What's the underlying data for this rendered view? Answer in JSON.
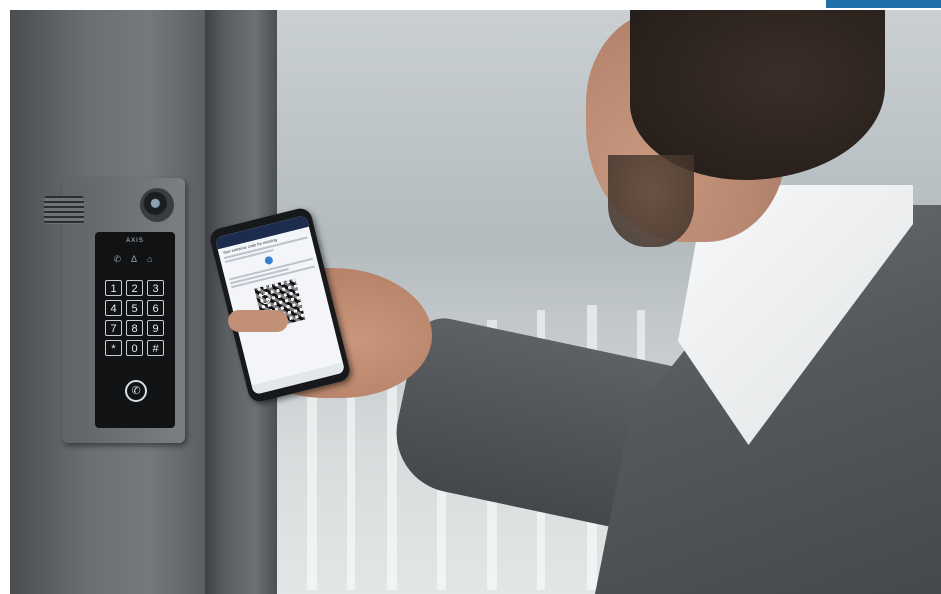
{
  "photo": {
    "description_icons": [
      "intercom-keypad",
      "smartphone-qr-code"
    ],
    "intercom": {
      "brand": "AXIS",
      "keys": [
        "1",
        "2",
        "3",
        "4",
        "5",
        "6",
        "7",
        "8",
        "9",
        "*",
        "0",
        "#"
      ],
      "call_glyph": "✆",
      "status_glyphs": "✆ Δ ⌂"
    },
    "phone": {
      "screen_title": "Your entrance code for meeting",
      "qr_visible": true
    },
    "colors": {
      "accent_tab": "#1f6fa8",
      "jacket": "#55595d",
      "shirt": "#f7f8f9"
    }
  }
}
